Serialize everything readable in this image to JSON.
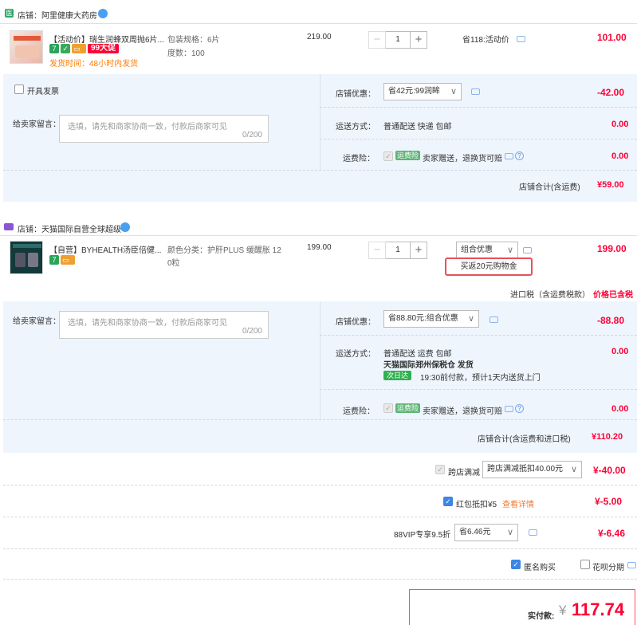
{
  "shop1": {
    "name": "店铺：阿里健康大药房",
    "product": {
      "title": "【活动价】瑞生润蜂双周抛6片...",
      "spec1": "包装规格：6片",
      "spec2": "度数：100",
      "badge": "99大促",
      "shipping": "发货时间：48小时内发货",
      "price": "219.00",
      "qty": "1",
      "saving": "省118:活动价",
      "subtotal": "101.00"
    },
    "invoice": "开具发票",
    "msg_label": "给卖家留言：",
    "msg_placeholder": "选填，请先和商家协商一致，付款后商家可见",
    "msg_count": "0/200",
    "discount_label": "店铺优惠：",
    "discount_select": "省42元:99润眸",
    "discount_value": "-42.00",
    "ship_label": "运送方式：",
    "ship_method": "普通配送 快递 包邮",
    "ship_value": "0.00",
    "ins_label": "运费险：",
    "ins_badge": "运费险",
    "ins_text": "卖家赠送，退换货可赔",
    "ins_value": "0.00",
    "total_label": "店铺合计(含运费)",
    "total_value": "¥59.00"
  },
  "shop2": {
    "name": "店铺：天猫国际自营全球超级",
    "product": {
      "title": "【自营】BYHEALTH汤臣倍健...",
      "spec1": "颜色分类：护肝PLUS 缓醒胀 12",
      "spec2": "0粒",
      "price": "199.00",
      "qty": "1",
      "promo_select": "组合优惠",
      "coupon": "买返20元购物金",
      "subtotal": "199.00"
    },
    "tax_label": "进口税（含运费税款）",
    "tax_value": "价格已含税",
    "msg_label": "给卖家留言：",
    "msg_placeholder": "选填，请先和商家协商一致，付款后商家可见",
    "msg_count": "0/200",
    "discount_label": "店铺优惠：",
    "discount_select": "省88.80元:组合优惠",
    "discount_value": "-88.80",
    "ship_label": "运送方式：",
    "ship_method": "普通配送 运费 包邮",
    "ship_warehouse": "天猫国际郑州保税仓  发货",
    "ship_badge": "次日达",
    "ship_time": "19:30前付款，预计1天内送货上门",
    "ship_value": "0.00",
    "ins_label": "运费险：",
    "ins_badge": "运费险",
    "ins_text": "卖家赠送，退换货可赔",
    "ins_value": "0.00",
    "total_label": "店铺合计(含运费和进口税)",
    "total_value": "¥110.20"
  },
  "summary": {
    "cross_label": "跨店满减",
    "cross_select": "跨店满减抵扣40.00元",
    "cross_value": "¥-40.00",
    "redpack_label": "红包抵扣¥5",
    "redpack_link": "查看详情",
    "redpack_value": "¥-5.00",
    "vip_label": "88VIP专享9.5折",
    "vip_select": "省6.46元",
    "vip_value": "¥-6.46",
    "anon_label": "匿名购买",
    "huabei_label": "花呗分期",
    "pay_label": "实付款:",
    "pay_currency": "¥",
    "pay_value": "117.74"
  },
  "colors": {
    "accent": "#ff0036",
    "blue_panel": "#eef5fd",
    "check_blue": "#3d86e5"
  }
}
